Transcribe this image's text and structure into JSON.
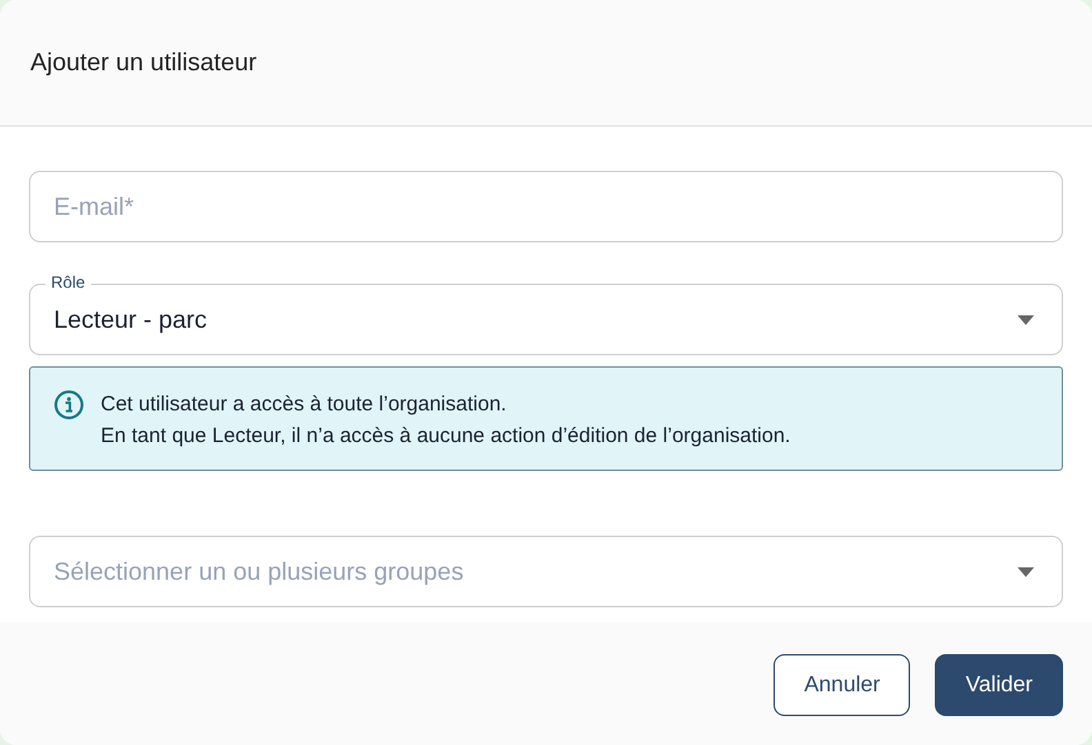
{
  "dialog": {
    "title": "Ajouter un utilisateur"
  },
  "email_field": {
    "placeholder": "E-mail*"
  },
  "role_field": {
    "label": "Rôle",
    "value": "Lecteur - parc"
  },
  "info": {
    "lines": [
      "Cet utilisateur a accès à toute l’organisation.",
      "En tant que Lecteur, il n’a accès à aucune action d’édition de l’organisation."
    ]
  },
  "groups_field": {
    "placeholder": "Sélectionner un ou plusieurs groupes"
  },
  "buttons": [
    {
      "label": "Annuler",
      "kind": "secondary"
    },
    {
      "label": "Valider",
      "kind": "primary"
    }
  ]
}
